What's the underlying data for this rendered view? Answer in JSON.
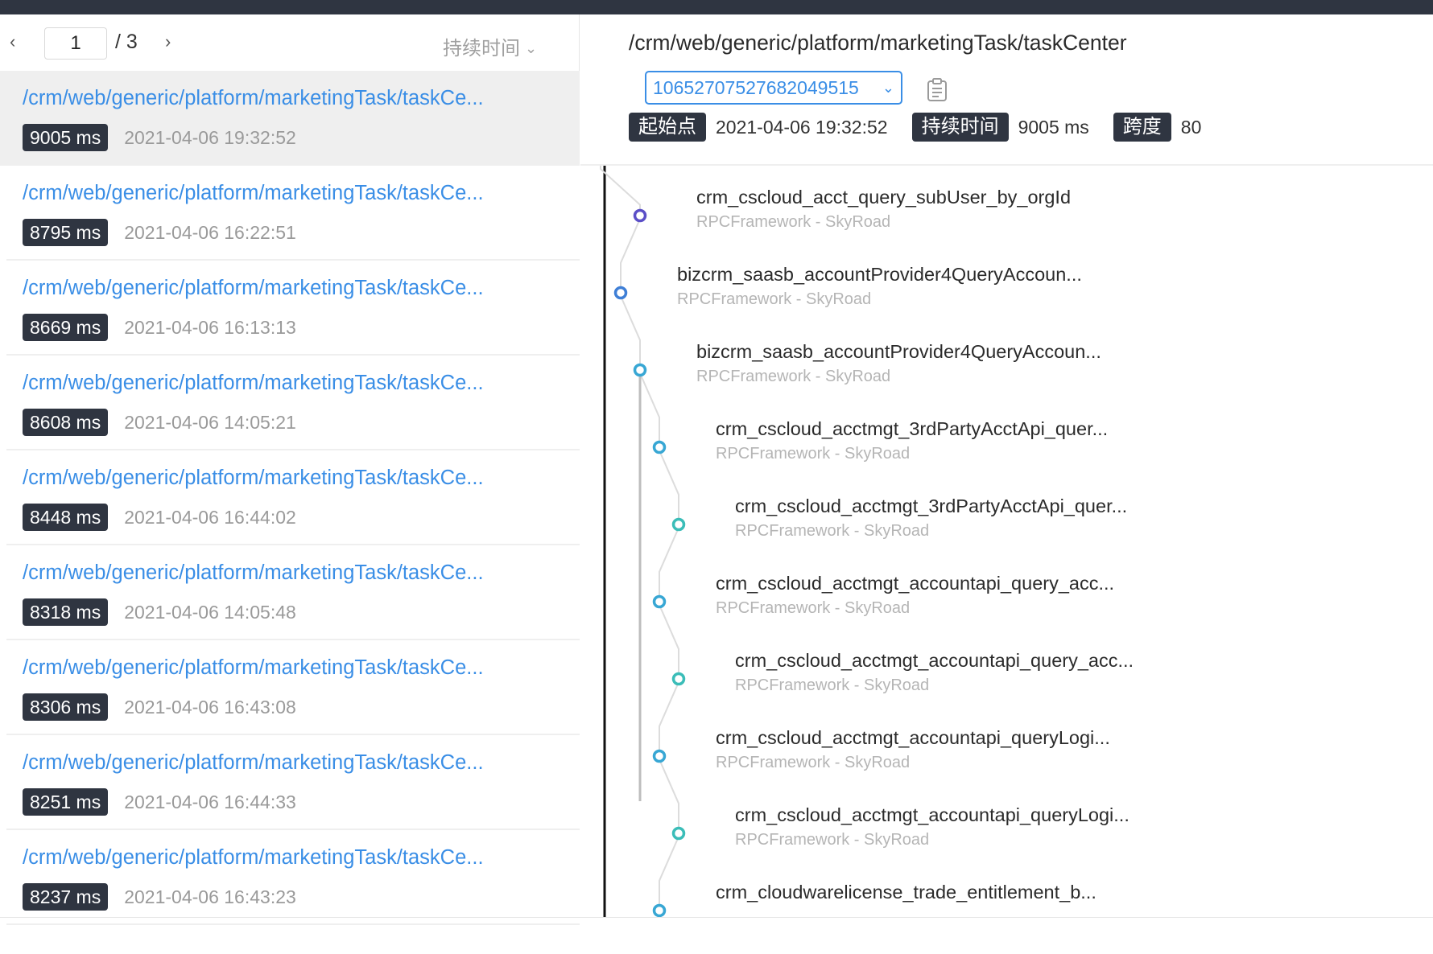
{
  "pager": {
    "current": "1",
    "total": "/ 3",
    "sort_label": "持续时间"
  },
  "list": [
    {
      "url": "/crm/web/generic/platform/marketingTask/taskCe...",
      "duration": "9005 ms",
      "time": "2021-04-06 19:32:52"
    },
    {
      "url": "/crm/web/generic/platform/marketingTask/taskCe...",
      "duration": "8795 ms",
      "time": "2021-04-06 16:22:51"
    },
    {
      "url": "/crm/web/generic/platform/marketingTask/taskCe...",
      "duration": "8669 ms",
      "time": "2021-04-06 16:13:13"
    },
    {
      "url": "/crm/web/generic/platform/marketingTask/taskCe...",
      "duration": "8608 ms",
      "time": "2021-04-06 14:05:21"
    },
    {
      "url": "/crm/web/generic/platform/marketingTask/taskCe...",
      "duration": "8448 ms",
      "time": "2021-04-06 16:44:02"
    },
    {
      "url": "/crm/web/generic/platform/marketingTask/taskCe...",
      "duration": "8318 ms",
      "time": "2021-04-06 14:05:48"
    },
    {
      "url": "/crm/web/generic/platform/marketingTask/taskCe...",
      "duration": "8306 ms",
      "time": "2021-04-06 16:43:08"
    },
    {
      "url": "/crm/web/generic/platform/marketingTask/taskCe...",
      "duration": "8251 ms",
      "time": "2021-04-06 16:44:33"
    },
    {
      "url": "/crm/web/generic/platform/marketingTask/taskCe...",
      "duration": "8237 ms",
      "time": "2021-04-06 16:43:23"
    }
  ],
  "detail": {
    "title": "/crm/web/generic/platform/marketingTask/taskCenter",
    "trace_id": "10652707527682049515",
    "start_label": "起始点",
    "start_value": "2021-04-06 19:32:52",
    "duration_label": "持续时间",
    "duration_value": "9005 ms",
    "span_label": "跨度",
    "span_value": "80"
  },
  "spans": [
    {
      "name": "crm_cscloud_acct_query_subUser_by_orgId",
      "sub": "RPCFramework - SkyRoad",
      "depth": 1,
      "color": "#5b4fc7"
    },
    {
      "name": "bizcrm_saasb_accountProvider4QueryAccoun...",
      "sub": "RPCFramework - SkyRoad",
      "depth": 0,
      "color": "#3f7fd6"
    },
    {
      "name": "bizcrm_saasb_accountProvider4QueryAccoun...",
      "sub": "RPCFramework - SkyRoad",
      "depth": 1,
      "color": "#38a7d4"
    },
    {
      "name": "crm_cscloud_acctmgt_3rdPartyAcctApi_quer...",
      "sub": "RPCFramework - SkyRoad",
      "depth": 2,
      "color": "#38a7d4"
    },
    {
      "name": "crm_cscloud_acctmgt_3rdPartyAcctApi_quer...",
      "sub": "RPCFramework - SkyRoad",
      "depth": 3,
      "color": "#3bbdb8"
    },
    {
      "name": "crm_cscloud_acctmgt_accountapi_query_acc...",
      "sub": "RPCFramework - SkyRoad",
      "depth": 2,
      "color": "#38a7d4"
    },
    {
      "name": "crm_cscloud_acctmgt_accountapi_query_acc...",
      "sub": "RPCFramework - SkyRoad",
      "depth": 3,
      "color": "#3bbdb8"
    },
    {
      "name": "crm_cscloud_acctmgt_accountapi_queryLogi...",
      "sub": "RPCFramework - SkyRoad",
      "depth": 2,
      "color": "#38a7d4"
    },
    {
      "name": "crm_cscloud_acctmgt_accountapi_queryLogi...",
      "sub": "RPCFramework - SkyRoad",
      "depth": 3,
      "color": "#3bbdb8"
    },
    {
      "name": "crm_cloudwarelicense_trade_entitlement_b...",
      "sub": "",
      "depth": 2,
      "color": "#38a7d4"
    }
  ]
}
